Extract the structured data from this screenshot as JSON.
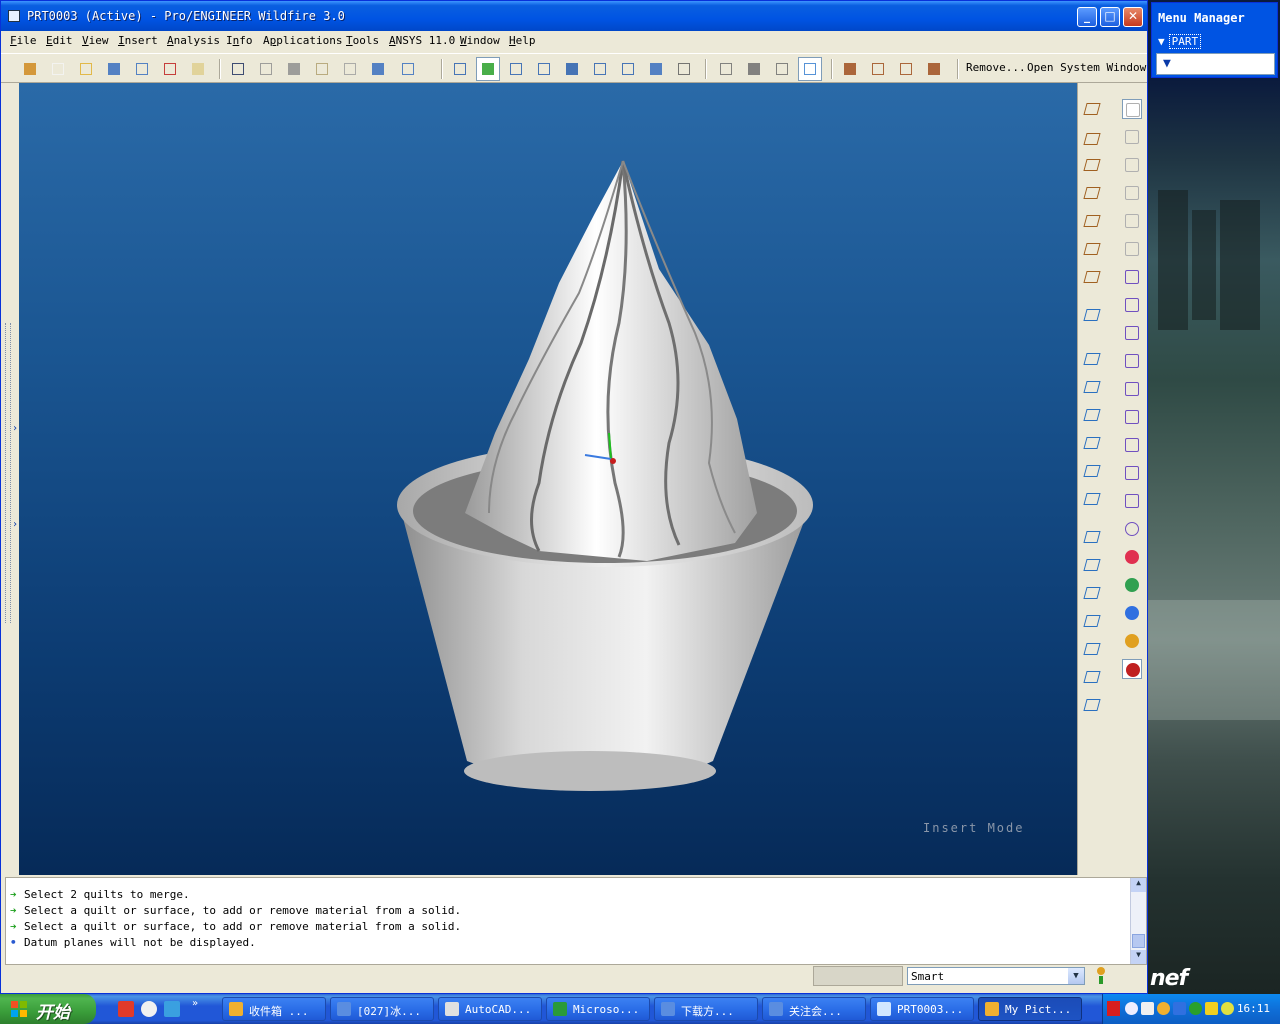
{
  "window": {
    "title": "PRT0003 (Active) - Pro/ENGINEER Wildfire 3.0",
    "controls": {
      "minimize": "_",
      "maximize": "□",
      "close": "✕"
    }
  },
  "menubar": {
    "items": [
      {
        "label": "File",
        "mnemonic": "F"
      },
      {
        "label": "Edit",
        "mnemonic": "E"
      },
      {
        "label": "View",
        "mnemonic": "V"
      },
      {
        "label": "Insert",
        "mnemonic": "I"
      },
      {
        "label": "Analysis",
        "mnemonic": "A"
      },
      {
        "label": "Info",
        "mnemonic": "n"
      },
      {
        "label": "Applications",
        "mnemonic": "p"
      },
      {
        "label": "Tools",
        "mnemonic": "T"
      },
      {
        "label": "ANSYS 11.0",
        "mnemonic": "A"
      },
      {
        "label": "Window",
        "mnemonic": "W"
      },
      {
        "label": "Help",
        "mnemonic": "H"
      }
    ]
  },
  "toolbar": {
    "remove_label": "Remove...",
    "open_system_window_label": "Open System Window",
    "icons": [
      "select-model-icon",
      "new-file-icon",
      "open-file-icon",
      "save-icon",
      "save-copy-icon",
      "erase-icon",
      "regenerate-icon",
      "undo-icon",
      "redo-icon",
      "copy-icon",
      "paste-icon",
      "paste-special-icon",
      "feature-tree-icon",
      "selection-box-icon",
      "repaint-icon",
      "spin-center-icon",
      "orient-icon",
      "zoom-in-icon",
      "zoom-out-icon",
      "refit-icon",
      "reorient-icon",
      "saved-views-icon",
      "layers-icon",
      "wireframe-icon",
      "hidden-line-icon",
      "no-hidden-icon",
      "shading-icon",
      "datum-planes-icon",
      "datum-axes-icon",
      "datum-points-icon",
      "coordinate-systems-icon"
    ]
  },
  "viewport": {
    "mode_label": "Insert Mode",
    "background_top": "#2a6aa8",
    "background_bottom": "#062a58",
    "model_description": "ice cream cup model"
  },
  "right_toolbar": {
    "col1": [
      "sketched-curve-icon",
      "datum-plane-icon",
      "datum-axis-icon",
      "datum-curve-icon",
      "datum-point-icon",
      "coord-sys-icon",
      "analysis-feature-icon",
      "sketch-tool-icon",
      "extrude-icon",
      "revolve-icon",
      "sweep-icon",
      "blend-icon",
      "draft-icon",
      "round-icon",
      "chamfer-icon",
      "hole-icon",
      "shell-icon",
      "rib-icon",
      "pattern-icon",
      "mirror-icon",
      "merge-icon",
      "trim-icon",
      "extend-icon",
      "offset-icon"
    ],
    "col2": [
      "model-tree-icon",
      "mirror-geom-icon",
      "copy-geom-icon",
      "move-geom-icon",
      "scale-geom-icon",
      "warp-icon",
      "style-icon",
      "freeform-icon",
      "boundary-blend-icon",
      "variable-section-icon",
      "pattern-table-icon",
      "group-icon",
      "solidify-icon",
      "thicken-icon",
      "cosmetic-icon",
      "appearance-icon",
      "material-icon",
      "render-icon",
      "lights-icon",
      "color-editor-icon",
      "spectrum-icon"
    ]
  },
  "messages": [
    {
      "type": "prompt",
      "text": "Select 2 quilts to merge."
    },
    {
      "type": "prompt",
      "text": "Select a quilt or surface, to add or remove material from a solid."
    },
    {
      "type": "prompt",
      "text": "Select a quilt or surface, to add or remove material from a solid."
    },
    {
      "type": "info",
      "text": "Datum planes will not be displayed."
    }
  ],
  "statusbar": {
    "filter_value": "Smart"
  },
  "menu_manager": {
    "title": "Menu Manager",
    "part_label": "PART"
  },
  "taskbar": {
    "start_label": "开始",
    "tasks": [
      {
        "label": "收件箱 ...",
        "icon_color": "#f0b030"
      },
      {
        "label": "[027]冰...",
        "icon_color": "#5a8de0"
      },
      {
        "label": "AutoCAD...",
        "icon_color": "#e0e0e0"
      },
      {
        "label": "Microso...",
        "icon_color": "#2a9a3a"
      },
      {
        "label": "下载方...",
        "icon_color": "#5a8de0"
      },
      {
        "label": "关注会...",
        "icon_color": "#5a8de0"
      },
      {
        "label": "PRT0003...",
        "icon_color": "#d0e6ff"
      },
      {
        "label": "My Pict...",
        "icon_color": "#f0b030"
      }
    ],
    "clock": "16:11"
  },
  "desktop": {
    "overlay_text": "nef"
  }
}
